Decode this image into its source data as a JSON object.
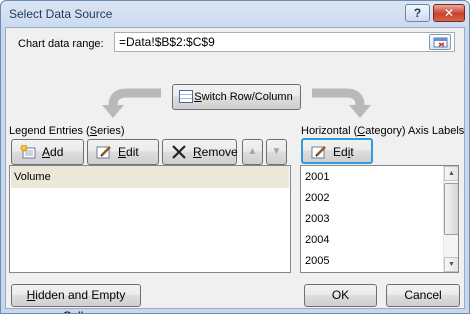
{
  "window": {
    "title": "Select Data Source"
  },
  "titlebar": {
    "help_label": "?",
    "close_label": "✕"
  },
  "range": {
    "label": "Chart data range:",
    "value": "=Data!$B$2:$C$9"
  },
  "switch": {
    "label_pre": "",
    "label_u": "S",
    "label_post": "witch Row/Column"
  },
  "legend": {
    "heading_pre": "Legend Entries (",
    "heading_u": "S",
    "heading_post": "eries)",
    "add_u": "A",
    "add_post": "dd",
    "edit_u": "E",
    "edit_post": "dit",
    "remove_u": "R",
    "remove_post": "emove",
    "series": [
      "Volume"
    ]
  },
  "axis": {
    "heading_pre": "Horizontal (",
    "heading_u": "C",
    "heading_post": "ategory) Axis Labels",
    "edit_pre": "Ed",
    "edit_u": "i",
    "edit_post": "t",
    "categories": [
      "2001",
      "2002",
      "2003",
      "2004",
      "2005"
    ]
  },
  "footer": {
    "hidden_u": "H",
    "hidden_post": "idden and Empty Cells",
    "ok": "OK",
    "cancel": "Cancel"
  }
}
